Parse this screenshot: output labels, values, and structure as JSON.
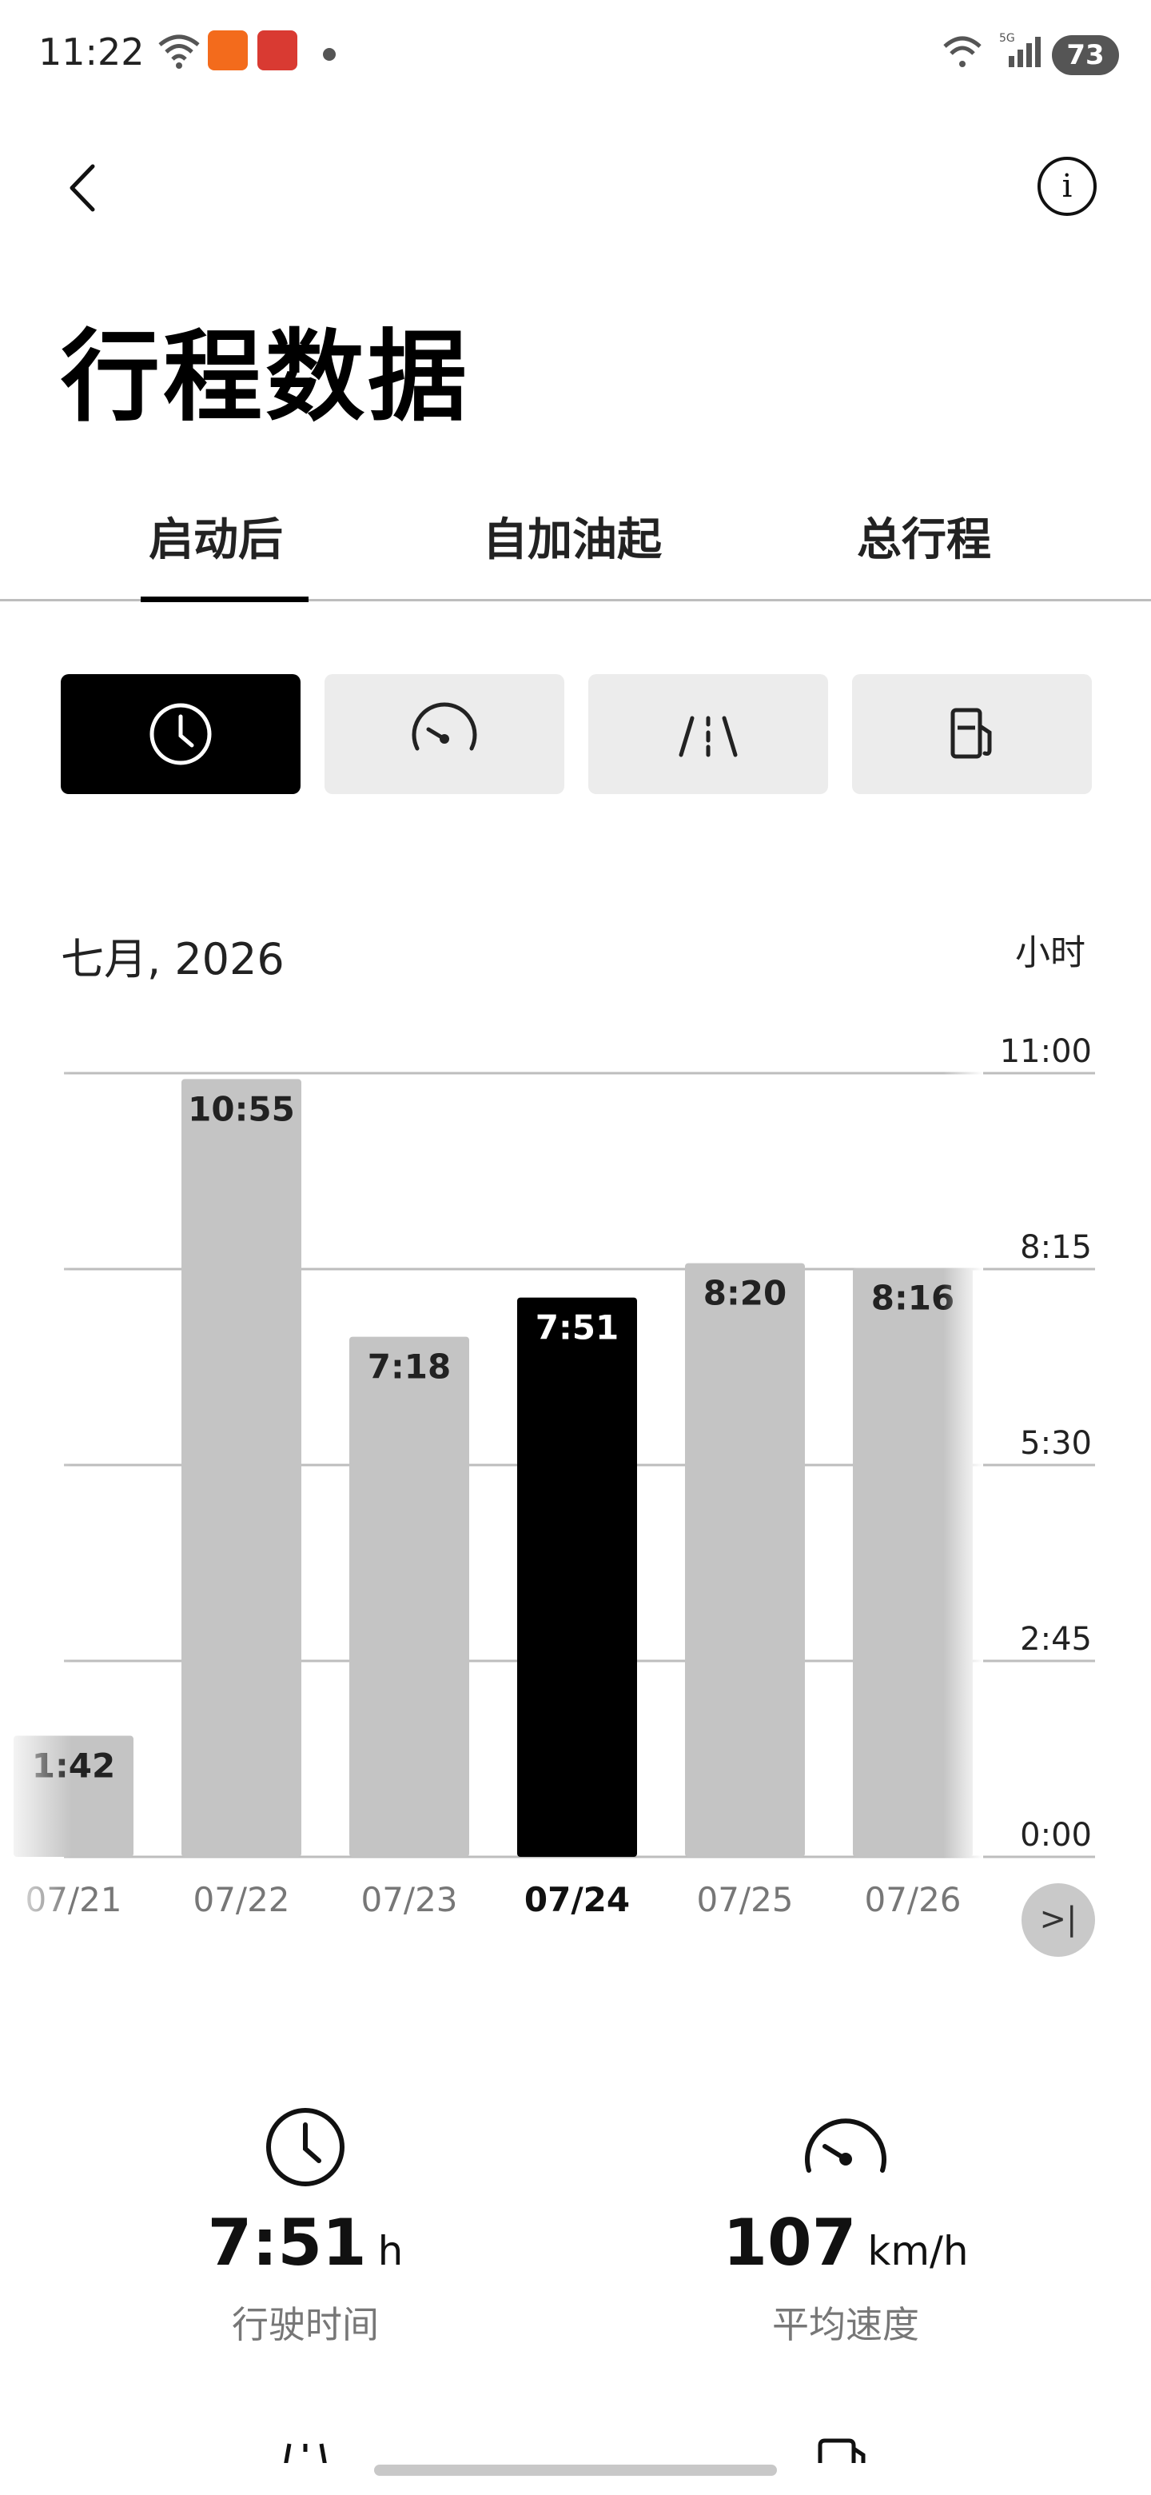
{
  "status_bar": {
    "time": "11:22",
    "battery": "73",
    "network": "5G"
  },
  "header": {
    "title": "行程数据",
    "info_glyph": "i"
  },
  "tabs": [
    {
      "label": "启动后",
      "active": true
    },
    {
      "label": "自加油起",
      "active": false
    },
    {
      "label": "总行程",
      "active": false
    }
  ],
  "metric_selector": [
    {
      "icon": "clock-icon",
      "active": true
    },
    {
      "icon": "speedometer-icon",
      "active": false
    },
    {
      "icon": "road-icon",
      "active": false
    },
    {
      "icon": "fuel-pump-icon",
      "active": false
    }
  ],
  "chart": {
    "month_label": "七月, 2026",
    "unit_label": "小时",
    "scroll_end_glyph": ">|"
  },
  "chart_data": {
    "type": "bar",
    "categories": [
      "07/21",
      "07/22",
      "07/23",
      "07/24",
      "07/25",
      "07/26"
    ],
    "values_minutes": [
      102,
      655,
      438,
      471,
      500,
      496
    ],
    "value_labels": [
      "1:42",
      "10:55",
      "7:18",
      "7:51",
      "8:20",
      "8:16"
    ],
    "selected": "07/24",
    "y_ticks": [
      "0:00",
      "2:45",
      "5:30",
      "8:15",
      "11:00"
    ],
    "ylim_minutes": [
      0,
      660
    ],
    "grid": true,
    "colors": {
      "bar": "#c4c4c4",
      "selected_bar": "#000000",
      "grid": "#bdbdbd"
    }
  },
  "stats": [
    {
      "icon": "clock-icon",
      "value": "7:51",
      "unit": "h",
      "label": "行驶时间"
    },
    {
      "icon": "speedometer-icon",
      "value": "107",
      "unit": "km/h",
      "label": "平均速度"
    }
  ]
}
